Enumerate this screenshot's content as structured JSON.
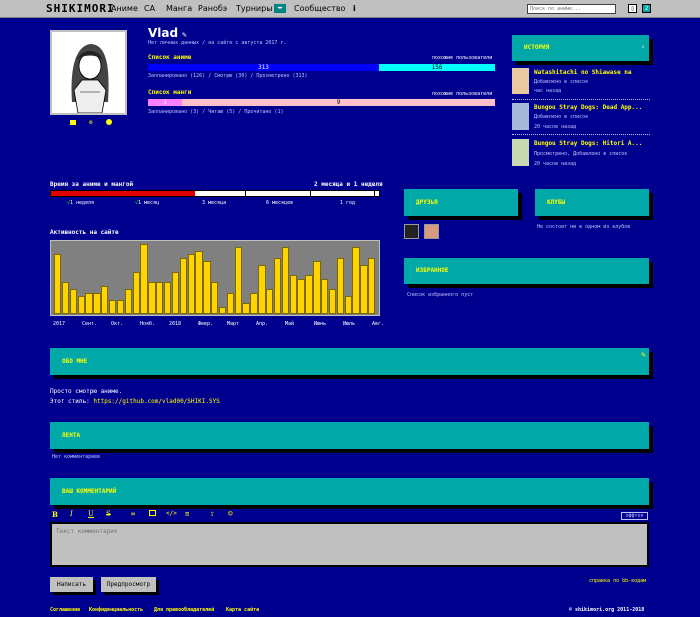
{
  "topbar": {
    "logo": "SHIKIMORI",
    "nav": [
      "Аниме",
      "СА",
      "Манга",
      "Ранобэ",
      "Турниры"
    ],
    "nav_badge": "◄►",
    "community": "Сообщество",
    "info": "i",
    "search_placeholder": "Поиск по аниме...",
    "btn1": "▯",
    "btn2": "2"
  },
  "profile": {
    "name": "Vlad",
    "subtitle": "Нет личных данных / на сайте с августа 2017 г.",
    "anime_title": "Список аниме",
    "anime_compare": "похожие пользователи",
    "anime_planned": 313,
    "anime_completed": 156,
    "anime_legend": "Запланировано (126) / Смотрю (30) / Просмотрено (313)",
    "manga_title": "Список манги",
    "manga_compare": "похожие пользователи",
    "manga_a": 1,
    "manga_b": 9,
    "manga_legend": "Запланировано (3) / Читаю (5) / Прочитано (1)"
  },
  "history": {
    "title": "ИСТОРИЯ",
    "items": [
      {
        "name": "Watashitachi no Shiawase na",
        "status": "Добавлено в список",
        "time": "час назад"
      },
      {
        "name": "Bungou Stray Dogs: Dead App...",
        "status": "Добавлено в список",
        "time": "20 часов назад"
      },
      {
        "name": "Bungou Stray Dogs: Hitori A...",
        "status": "Просмотрено, Добавлено в список",
        "time": "20 часов назад"
      }
    ]
  },
  "time": {
    "title": "Время за аниме и мангой",
    "value": "2 месяца и 1 неделя",
    "labels": [
      "1 неделя",
      "1 месяц",
      "3 месяца",
      "6 месяцев",
      "1 год"
    ]
  },
  "activity": {
    "title": "Активность на сайте",
    "months": [
      "2017",
      "Сент.",
      "Окт.",
      "Нояб.",
      "2018",
      "Февр.",
      "Март",
      "Апр.",
      "Май",
      "Июнь",
      "Июль",
      "Авг."
    ],
    "values": [
      0.85,
      0.45,
      0.35,
      0.25,
      0.3,
      0.3,
      0.4,
      0.2,
      0.2,
      0.35,
      0.6,
      1.0,
      0.45,
      0.45,
      0.45,
      0.6,
      0.8,
      0.85,
      0.9,
      0.75,
      0.45,
      0.1,
      0.3,
      0.95,
      0.15,
      0.3,
      0.7,
      0.35,
      0.8,
      0.95,
      0.55,
      0.5,
      0.55,
      0.75,
      0.5,
      0.35,
      0.8,
      0.25,
      0.95,
      0.7,
      0.8
    ]
  },
  "friends": {
    "title": "ДРУЗЬЯ"
  },
  "clubs": {
    "title": "КЛУБЫ",
    "empty": "Не состоит ни в одном из клубов"
  },
  "favorites": {
    "title": "ИЗБРАННОЕ",
    "empty": "Список избранного пуст"
  },
  "about": {
    "title": "ОБО МНЕ",
    "line1": "Просто смотрю аниме.",
    "line2_label": "Этот стиль:",
    "line2_link": "https://github.com/vlad00/SHIKI.SYS"
  },
  "feed": {
    "title": "ЛЕНТА",
    "empty": "Нет комментариев"
  },
  "comment": {
    "title": "ВАШ КОММЕНТАРИЙ",
    "placeholder": "Текст комментария",
    "offtopic": "оффтоп",
    "submit": "Написать",
    "preview": "Предпросмотр",
    "help": "справка по bb-кодам"
  },
  "footer": {
    "links": [
      "Соглашение",
      "Конфиденциальность",
      "Для правообладателей",
      "Карта сайта"
    ],
    "copyright": "© shikimori.org 2011-2018"
  },
  "colors": {
    "bg": "#00008f",
    "panel": "#00a8a8",
    "accent": "#ffff00",
    "anime_done": "#0000ff",
    "anime_plan": "#00ffff",
    "manga_a": "#ff80ff",
    "manga_b": "#ffc0cb",
    "bar_yellow": "#ffd400",
    "timeline_red": "#e00000"
  }
}
